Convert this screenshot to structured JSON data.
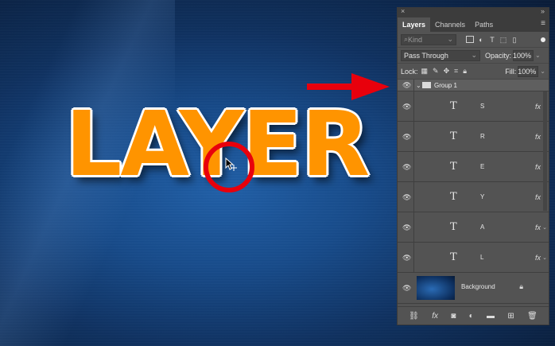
{
  "canvas": {
    "word": "LAYER"
  },
  "panel": {
    "close_glyph": "×",
    "collapse_glyph": "»",
    "tabs": [
      "Layers",
      "Channels",
      "Paths"
    ],
    "menu_glyph": "≡",
    "filter": {
      "placeholder": "Kind",
      "icons": [
        "image-filter-icon",
        "adjustment-filter-icon",
        "type-filter-icon",
        "shape-filter-icon",
        "smart-object-filter-icon"
      ]
    },
    "blend_mode": "Pass Through",
    "opacity_label": "Opacity:",
    "opacity_value": "100%",
    "lock_label": "Lock:",
    "fill_label": "Fill:",
    "fill_value": "100%",
    "group_name": "Group 1",
    "layers": [
      {
        "glyph": "T",
        "name": "S",
        "fx": "fx"
      },
      {
        "glyph": "T",
        "name": "R",
        "fx": "fx"
      },
      {
        "glyph": "T",
        "name": "E",
        "fx": "fx"
      },
      {
        "glyph": "T",
        "name": "Y",
        "fx": "fx"
      },
      {
        "glyph": "T",
        "name": "A",
        "fx": "fx"
      },
      {
        "glyph": "T",
        "name": "L",
        "fx": "fx"
      }
    ],
    "background_layer": "Background",
    "bottom_fx": "fx"
  },
  "colors": {
    "accent_red": "#e8000c",
    "text_orange": "#ff9400",
    "panel_bg": "#535353"
  }
}
